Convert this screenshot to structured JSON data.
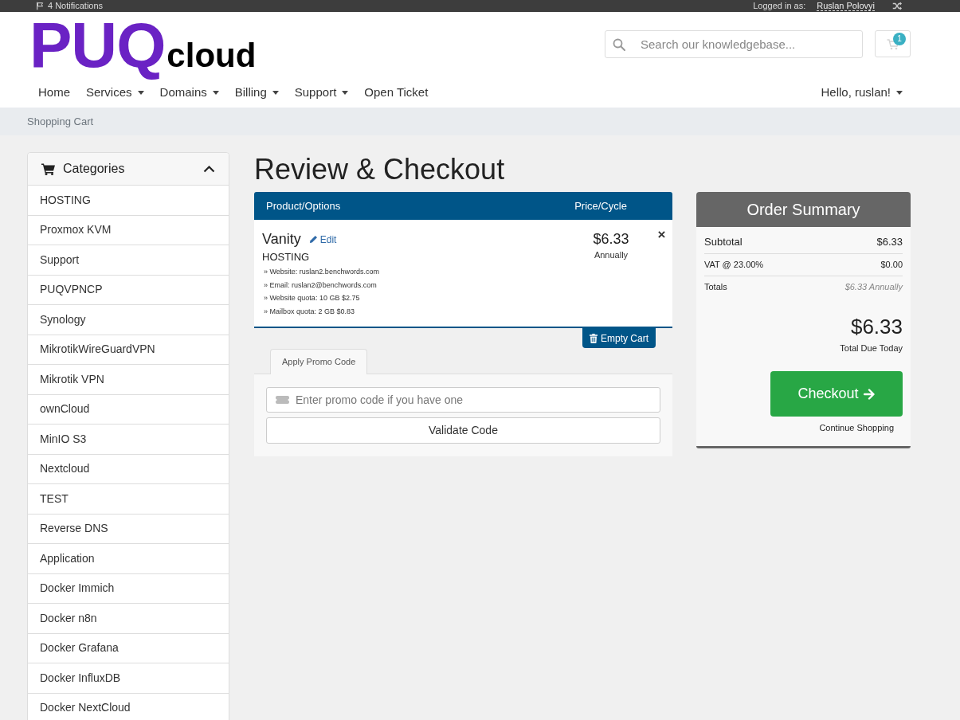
{
  "top_bar": {
    "notifications": "4 Notifications",
    "logged_in_label": "Logged in as:",
    "user_name": "Ruslan Polovyi"
  },
  "header": {
    "logo": {
      "main": "PUQ",
      "suffix": "cloud"
    },
    "search": {
      "placeholder": "Search our knowledgebase..."
    },
    "cart_count": "1"
  },
  "nav": {
    "items": [
      {
        "label": "Home",
        "dropdown": false
      },
      {
        "label": "Services",
        "dropdown": true
      },
      {
        "label": "Domains",
        "dropdown": true
      },
      {
        "label": "Billing",
        "dropdown": true
      },
      {
        "label": "Support",
        "dropdown": true
      },
      {
        "label": "Open Ticket",
        "dropdown": false
      }
    ],
    "account": {
      "label": "Hello, ruslan!",
      "dropdown": true
    }
  },
  "breadcrumb": "Shopping Cart",
  "sidebar": {
    "title": "Categories",
    "expanded": true,
    "items": [
      "HOSTING",
      "Proxmox KVM",
      "Support",
      "PUQVPNCP",
      "Synology",
      "MikrotikWireGuardVPN",
      "Mikrotik VPN",
      "ownCloud",
      "MinIO S3",
      "Nextcloud",
      "TEST",
      "Reverse DNS",
      "Application",
      "Docker Immich",
      "Docker n8n",
      "Docker Grafana",
      "Docker InfluxDB",
      "Docker NextCloud"
    ]
  },
  "page_title": "Review & Checkout",
  "cart": {
    "columns": [
      "Product/Options",
      "Price/Cycle"
    ],
    "items": [
      {
        "name": "Vanity",
        "edit": "Edit",
        "group": "HOSTING",
        "options": [
          "» Website: ruslan2.benchwords.com",
          "» Email: ruslan2@benchwords.com",
          "» Website quota: 10 GB $2.75",
          "» Mailbox quota: 2 GB $0.83"
        ],
        "price": "$6.33",
        "cycle": "Annually",
        "remove": "×"
      }
    ],
    "empty_button": "Empty Cart"
  },
  "promo": {
    "tabs": [
      {
        "label": "Apply Promo Code",
        "selected": true
      }
    ],
    "placeholder": "Enter promo code if you have one",
    "button": "Validate Code"
  },
  "summary": {
    "title": "Order Summary",
    "rows": [
      {
        "kind": "subtotal",
        "label": "Subtotal",
        "value": "$6.33"
      },
      {
        "kind": "tax",
        "label": "VAT @ 23.00%",
        "value": "$0.00"
      },
      {
        "kind": "recurring",
        "label": "Totals",
        "value": "$6.33 Annually"
      }
    ],
    "total": "$6.33",
    "total_label": "Total Due Today",
    "checkout": "Checkout",
    "continue": "Continue Shopping"
  }
}
